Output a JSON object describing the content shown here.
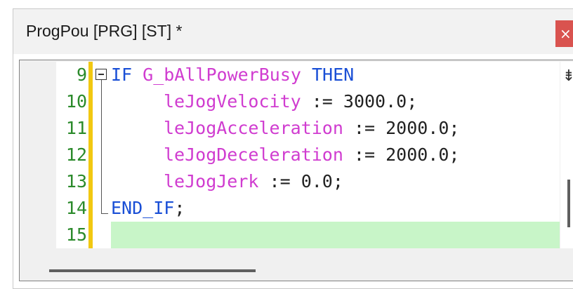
{
  "window": {
    "title": "ProgPou [PRG] [ST] *",
    "close_label": "×"
  },
  "editor": {
    "lines": [
      {
        "number": "9",
        "tokens": [
          {
            "t": "IF ",
            "c": "kw"
          },
          {
            "t": "G_bAllPowerBusy",
            "c": "var"
          },
          {
            "t": " THEN",
            "c": "kw"
          }
        ],
        "indent": 0,
        "fold": "start"
      },
      {
        "number": "10",
        "tokens": [
          {
            "t": "leJogVelocity",
            "c": "var"
          },
          {
            "t": " := ",
            "c": "op"
          },
          {
            "t": "3000.0;",
            "c": "num"
          }
        ],
        "indent": 1
      },
      {
        "number": "11",
        "tokens": [
          {
            "t": "leJogAcceleration",
            "c": "var"
          },
          {
            "t": " := ",
            "c": "op"
          },
          {
            "t": "2000.0;",
            "c": "num"
          }
        ],
        "indent": 1
      },
      {
        "number": "12",
        "tokens": [
          {
            "t": "leJogDeceleration",
            "c": "var"
          },
          {
            "t": " := ",
            "c": "op"
          },
          {
            "t": "2000.0;",
            "c": "num"
          }
        ],
        "indent": 1
      },
      {
        "number": "13",
        "tokens": [
          {
            "t": "leJogJerk",
            "c": "var"
          },
          {
            "t": " := ",
            "c": "op"
          },
          {
            "t": "0.0;",
            "c": "num"
          }
        ],
        "indent": 1
      },
      {
        "number": "14",
        "tokens": [
          {
            "t": "END_IF",
            "c": "kw"
          },
          {
            "t": ";",
            "c": "op"
          }
        ],
        "indent": 0,
        "fold": "end"
      },
      {
        "number": "15",
        "tokens": [],
        "indent": 0,
        "current": true
      }
    ],
    "colors": {
      "keyword": "#1a4fd6",
      "variable": "#d03cd0",
      "line_number": "#2b8a2b",
      "change_bar": "#f2c811",
      "current_line": "#c8f5c8"
    }
  },
  "scrollbars": {
    "splitter_icon": "⇟"
  }
}
